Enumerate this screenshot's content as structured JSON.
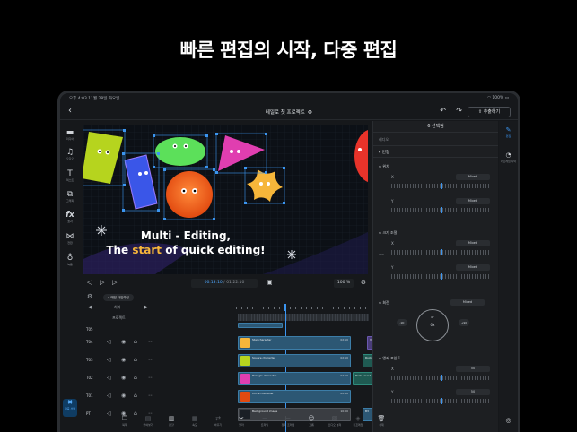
{
  "headline": "빠른 편집의 시작, 다중 편집",
  "status": {
    "time": "오후 4:03  11월 28일 화요일",
    "battery": "100%"
  },
  "titlebar": {
    "project_title": "테일로 첫 프로젝트",
    "export_label": "추출하기"
  },
  "left_tools": [
    {
      "icon": "folder-icon",
      "label": "미디어"
    },
    {
      "icon": "music-icon",
      "label": "오디오"
    },
    {
      "icon": "text-icon",
      "label": "텍스트"
    },
    {
      "icon": "shapes-icon",
      "label": "그래픽"
    },
    {
      "icon": "fx-icon",
      "label": "효과"
    },
    {
      "icon": "transition-icon",
      "label": "전환"
    },
    {
      "icon": "mic-icon",
      "label": "녹음"
    }
  ],
  "multi_select": {
    "label": "다중\n선택"
  },
  "preview": {
    "caption_line1": "Multi - Editing,",
    "caption_line2_a": "The ",
    "caption_line2_b": "start",
    "caption_line2_c": " of quick editing!"
  },
  "playback": {
    "current": "00:13:10",
    "total": "01:22:10",
    "zoom": "100 %"
  },
  "right_panel": {
    "header": "6 선택됨",
    "tab": "레디오",
    "section": "변형",
    "position_label": "위치",
    "scale_label": "크기 조절",
    "rotation_label": "회전",
    "anchor_label": "앵커 포인트",
    "axis_x": "X",
    "axis_y": "Y",
    "mixed": "Mixed",
    "rotation_value": "0x",
    "rotation_deg": "0°",
    "rot_minus": "-90",
    "rot_plus": "+90",
    "anchor_value": "50",
    "chain_value": "100"
  },
  "far_right": {
    "edit_label": "편집",
    "keyframe_label": "키프레임 사이"
  },
  "timeline": {
    "layer_chip": "메인 타임라인",
    "ruler_label": "처리",
    "main_clip_label": "프로젝트",
    "tracks": [
      {
        "name": "T05",
        "clips": []
      },
      {
        "name": "T04",
        "clips": [
          {
            "label": "Star character",
            "dur": "02:10"
          },
          {
            "label": "Video effect : RGB",
            "dur": ""
          }
        ]
      },
      {
        "name": "T03",
        "clips": [
          {
            "label": "Square character",
            "dur": "02:10"
          },
          {
            "label": "Rock sound 03:10",
            "dur": ""
          }
        ]
      },
      {
        "name": "T02",
        "clips": [
          {
            "label": "Triangle character",
            "dur": "02:10"
          },
          {
            "label": "Rock sound 02:10",
            "dur": ""
          },
          {
            "label": "arrow",
            "dur": ""
          }
        ]
      },
      {
        "name": "T01",
        "clips": [
          {
            "label": "Circle character",
            "dur": "02:10"
          }
        ]
      },
      {
        "name": "PT",
        "clips": [
          {
            "label": "Background image",
            "dur": "10:00"
          },
          {
            "label": "B3",
            "dur": ""
          }
        ]
      }
    ]
  },
  "bottom_tools": [
    {
      "icon": "copy-icon",
      "label": "복제"
    },
    {
      "icon": "paste-icon",
      "label": "붙여넣기"
    },
    {
      "icon": "split-icon",
      "label": "분할"
    },
    {
      "icon": "speed-icon",
      "label": "속도"
    },
    {
      "icon": "replace-icon",
      "label": "바꾸기"
    },
    {
      "icon": "cut-icon",
      "label": "잘라"
    },
    {
      "icon": "trim-icon",
      "label": "트리밍"
    },
    {
      "icon": "freeze-icon",
      "label": "정지 프레임"
    },
    {
      "icon": "group-icon",
      "label": "그룹"
    },
    {
      "icon": "detach-icon",
      "label": "오디오 분리"
    },
    {
      "icon": "keyframe-icon",
      "label": "키프레임"
    },
    {
      "icon": "trash-icon",
      "label": "삭제"
    }
  ],
  "colors": {
    "accent": "#3b95f0",
    "bg": "#16181b",
    "panel": "#1d1f22"
  }
}
